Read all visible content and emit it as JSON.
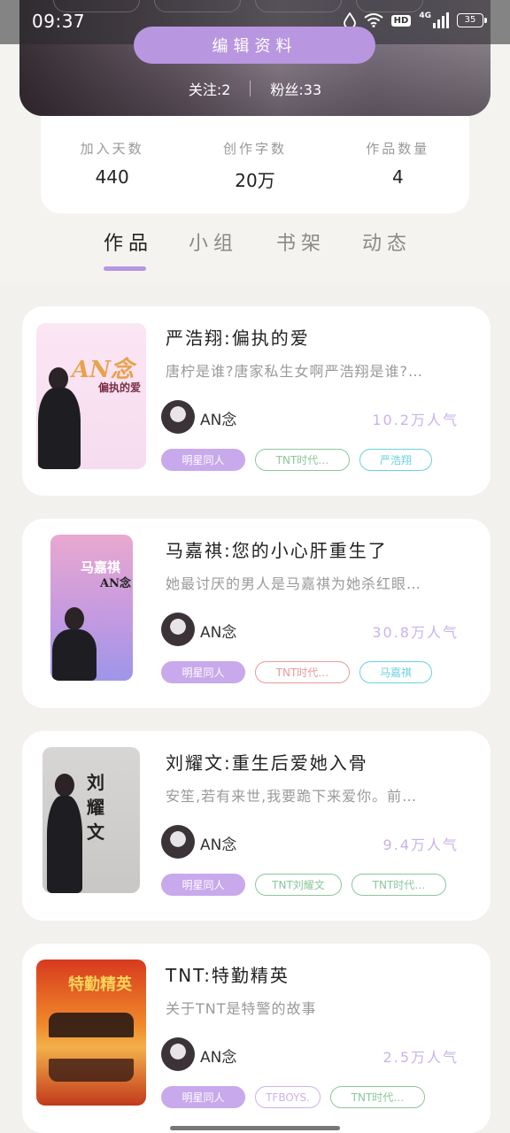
{
  "status_bar": {
    "time": "09:37",
    "icons": [
      "drop-icon",
      "wifi-icon",
      "hd-icon",
      "4g-signal-icon",
      "battery-icon"
    ],
    "hd_label": "HD",
    "network_label": "4G",
    "battery_level": "35"
  },
  "profile": {
    "edit_label": "编辑资料",
    "following_text": "关注:2",
    "followers_text": "粉丝:33"
  },
  "stats": [
    {
      "label": "加入天数",
      "value": "440"
    },
    {
      "label": "创作字数",
      "value": "20万"
    },
    {
      "label": "作品数量",
      "value": "4"
    }
  ],
  "tabs": [
    {
      "label": "作品",
      "active": true
    },
    {
      "label": "小组",
      "active": false
    },
    {
      "label": "书架",
      "active": false
    },
    {
      "label": "动态",
      "active": false
    }
  ],
  "colors": {
    "accent": "#b896e0",
    "tag_filled": "#c8a9ec",
    "tag_green": "#8bc79a",
    "tag_red": "#e89a9a",
    "tag_cyan": "#6cd0df",
    "popularity": "#c9b3ea"
  },
  "works": [
    {
      "title": "严浩翔:偏执的爱",
      "description": "唐柠是谁?唐家私生女啊严浩翔是谁?…",
      "author": "AN念",
      "popularity": "10.2万人气",
      "cover_text": "AN念",
      "cover_subtext": "偏执的爱",
      "tags": [
        {
          "label": "明星同人",
          "style": "filled"
        },
        {
          "label": "TNT时代…",
          "style": "green"
        },
        {
          "label": "严浩翔",
          "style": "cyan"
        }
      ]
    },
    {
      "title": "马嘉祺:您的小心肝重生了",
      "description": "她最讨厌的男人是马嘉祺为她杀红眼…",
      "author": "AN念",
      "popularity": "30.8万人气",
      "cover_text": "马嘉祺",
      "cover_subtext": "AN念",
      "tags": [
        {
          "label": "明星同人",
          "style": "filled"
        },
        {
          "label": "TNT时代…",
          "style": "red"
        },
        {
          "label": "马嘉祺",
          "style": "cyan"
        }
      ]
    },
    {
      "title": "刘耀文:重生后爱她入骨",
      "description": "安笙,若有来世,我要跪下来爱你。前…",
      "author": "AN念",
      "popularity": "9.4万人气",
      "cover_text": "刘耀文",
      "cover_subtext": "",
      "tags": [
        {
          "label": "明星同人",
          "style": "filled"
        },
        {
          "label": "TNT刘耀文",
          "style": "green"
        },
        {
          "label": "TNT时代…",
          "style": "green"
        }
      ]
    },
    {
      "title": "TNT:特勤精英",
      "description": "关于TNT是特警的故事",
      "author": "AN念",
      "popularity": "2.5万人气",
      "cover_text": "特勤精英",
      "cover_subtext": "",
      "tags": [
        {
          "label": "明星同人",
          "style": "filled"
        },
        {
          "label": "TFBOYS.",
          "style": "purple"
        },
        {
          "label": "TNT时代…",
          "style": "green"
        }
      ]
    }
  ]
}
